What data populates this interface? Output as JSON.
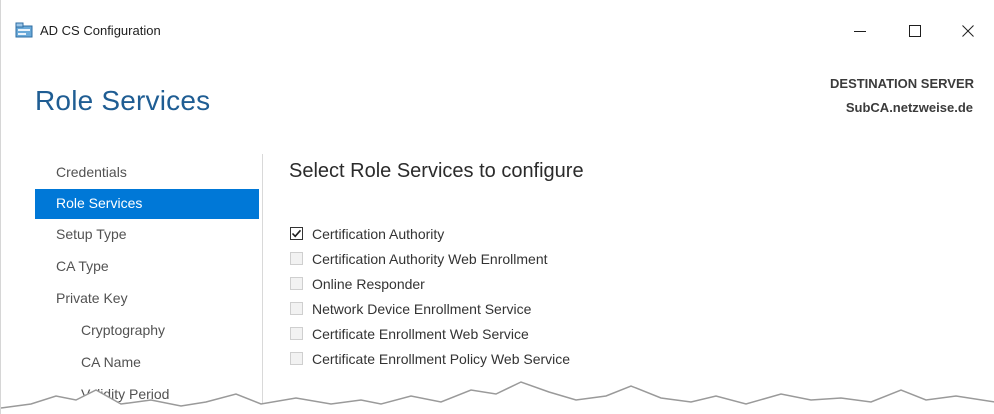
{
  "window": {
    "title": "AD CS Configuration",
    "icon": "server-certificate-icon"
  },
  "header": {
    "page_title": "Role Services",
    "destination_label": "DESTINATION SERVER",
    "destination_value": "SubCA.netzweise.de"
  },
  "nav": {
    "items": [
      {
        "label": "Credentials",
        "selected": false,
        "sub": false
      },
      {
        "label": "Role Services",
        "selected": true,
        "sub": false
      },
      {
        "label": "Setup Type",
        "selected": false,
        "sub": false
      },
      {
        "label": "CA Type",
        "selected": false,
        "sub": false
      },
      {
        "label": "Private Key",
        "selected": false,
        "sub": false
      },
      {
        "label": "Cryptography",
        "selected": false,
        "sub": true
      },
      {
        "label": "CA Name",
        "selected": false,
        "sub": true
      },
      {
        "label": "Validity Period",
        "selected": false,
        "sub": true
      }
    ]
  },
  "main": {
    "section_title": "Select Role Services to configure",
    "options": [
      {
        "label": "Certification Authority",
        "checked": true,
        "enabled": true
      },
      {
        "label": "Certification Authority Web Enrollment",
        "checked": false,
        "enabled": false
      },
      {
        "label": "Online Responder",
        "checked": false,
        "enabled": false
      },
      {
        "label": "Network Device Enrollment Service",
        "checked": false,
        "enabled": false
      },
      {
        "label": "Certificate Enrollment Web Service",
        "checked": false,
        "enabled": false
      },
      {
        "label": "Certificate Enrollment Policy Web Service",
        "checked": false,
        "enabled": false
      }
    ]
  },
  "colors": {
    "accent": "#0078d7",
    "title_blue": "#1f5d93"
  }
}
